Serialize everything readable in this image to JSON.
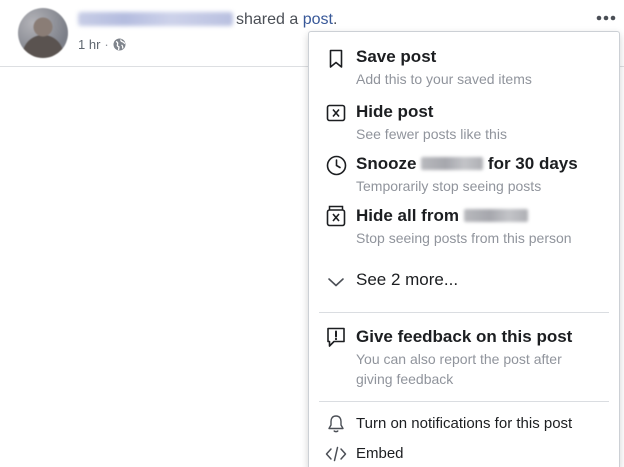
{
  "post": {
    "action_text": "shared a",
    "link_text": "post",
    "period": ".",
    "time": "1 hr",
    "separator": "·"
  },
  "menu": {
    "save": {
      "title": "Save post",
      "subtitle": "Add this to your saved items"
    },
    "hide": {
      "title": "Hide post",
      "subtitle": "See fewer posts like this"
    },
    "snooze": {
      "title_prefix": "Snooze",
      "title_suffix": "for 30 days",
      "subtitle": "Temporarily stop seeing posts"
    },
    "hide_all": {
      "title": "Hide all from",
      "subtitle": "Stop seeing posts from this person"
    },
    "see_more": {
      "label": "See 2 more..."
    },
    "feedback": {
      "title": "Give feedback on this post",
      "subtitle_line1": "You can also report the post after",
      "subtitle_line2": "giving feedback"
    },
    "notifications": {
      "label": "Turn on notifications for this post"
    },
    "embed": {
      "label": "Embed"
    }
  },
  "colors": {
    "link": "#385898",
    "text": "#1c1e21",
    "secondary": "#90949c",
    "divider": "#dadde1"
  },
  "icons": [
    "more-horizontal-icon",
    "globe-icon",
    "bookmark-icon",
    "hide-x-box-icon",
    "clock-icon",
    "hide-all-icon",
    "chevron-down-icon",
    "feedback-icon",
    "bell-icon",
    "code-icon"
  ]
}
